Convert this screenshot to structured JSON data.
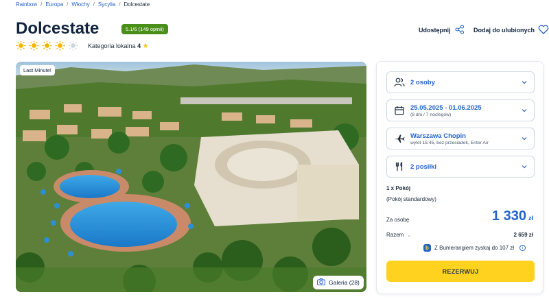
{
  "breadcrumb": {
    "items": [
      "Rainbow",
      "Europa",
      "Włochy",
      "Sycylia"
    ],
    "current": "Dolcestate"
  },
  "hotel": {
    "name": "Dolcestate",
    "rating": "5.1/6 (149 opinii)",
    "sun_rating": 4,
    "sun_max": 5,
    "category_label": "Kategoria lokalna",
    "category_value": "4"
  },
  "actions": {
    "share": "Udostępnij",
    "favorite": "Dodaj do ulubionych"
  },
  "gallery": {
    "badge": "Last Minute!",
    "button": "Galeria (28)"
  },
  "booking": {
    "persons": "2 osoby",
    "dates": "25.05.2025 - 01.06.2025",
    "nights": "(8 dni / 7 noclegów)",
    "airport": "Warszawa Chopin",
    "flight": "wylot 15:45, bez przesiadek, Enter Air",
    "meals": "2 posiłki",
    "room": "1 x Pokój",
    "room_type": "(Pokój standardowy)",
    "per_person_label": "Za osobę",
    "price": "1 330",
    "currency": "zł",
    "total_label": "Razem",
    "total": "2 659 zł",
    "bumerang": "Z Bumerangiem zyskaj do 107 zł",
    "reserve": "REZERWUJ"
  },
  "colors": {
    "accent": "#2563c9",
    "rating_bg": "#4a8f1a",
    "button": "#ffd21f"
  }
}
